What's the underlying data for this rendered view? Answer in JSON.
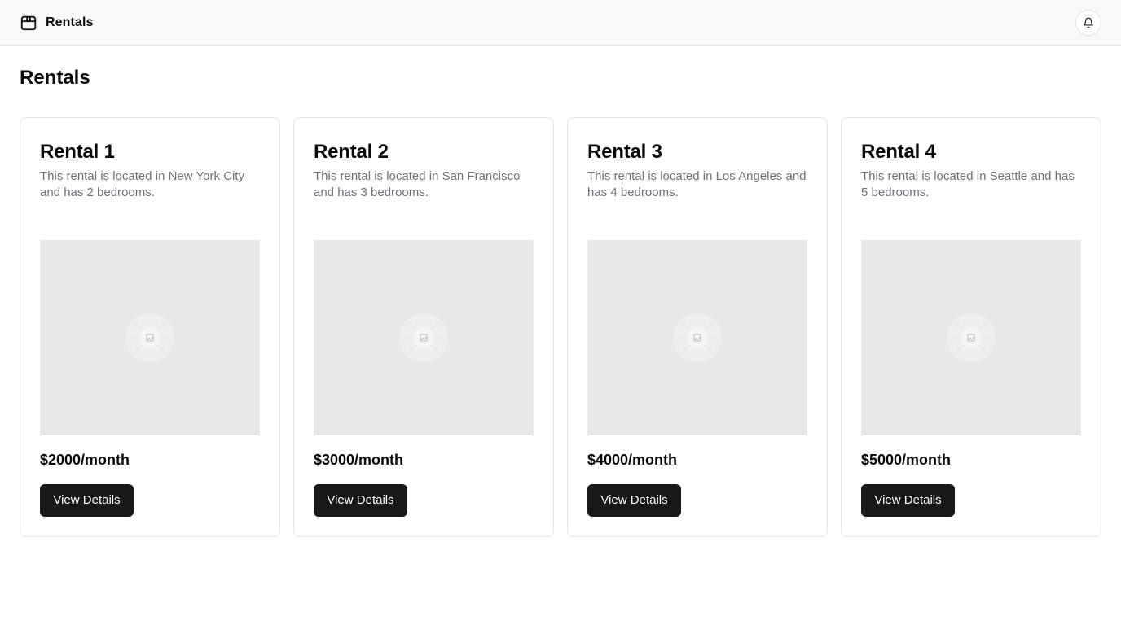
{
  "header": {
    "brand_icon": "package-icon",
    "brand_label": "Rentals",
    "notification_icon": "bell-icon"
  },
  "main": {
    "title": "Rentals",
    "cards": [
      {
        "title": "Rental 1",
        "description": "This rental is located in New York City and has 2 bedrooms.",
        "image_icon": "image-placeholder-icon",
        "price": "$2000/month",
        "button_label": "View Details"
      },
      {
        "title": "Rental 2",
        "description": "This rental is located in San Francisco and has 3 bedrooms.",
        "image_icon": "image-placeholder-icon",
        "price": "$3000/month",
        "button_label": "View Details"
      },
      {
        "title": "Rental 3",
        "description": "This rental is located in Los Angeles and has 4 bedrooms.",
        "image_icon": "image-placeholder-icon",
        "price": "$4000/month",
        "button_label": "View Details"
      },
      {
        "title": "Rental 4",
        "description": "This rental is located in Seattle and has 5 bedrooms.",
        "image_icon": "image-placeholder-icon",
        "price": "$5000/month",
        "button_label": "View Details"
      }
    ]
  },
  "colors": {
    "header_background": "#f8f9f9",
    "primary_button": "#18181b",
    "muted_text": "#71717a",
    "image_placeholder": "#e8e8e8"
  }
}
